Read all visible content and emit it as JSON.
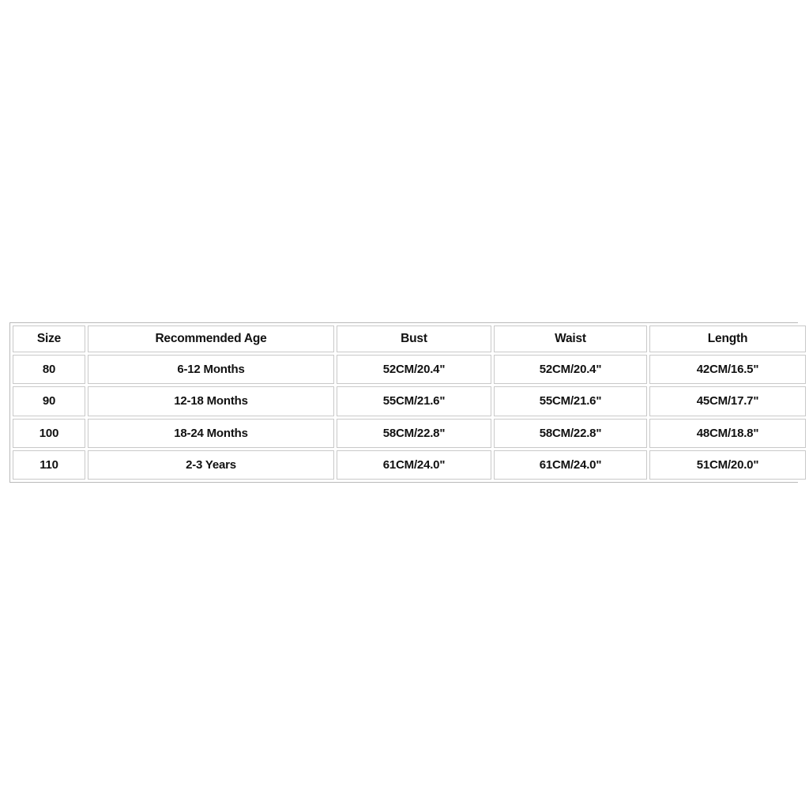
{
  "chart_data": {
    "type": "table",
    "title": "",
    "columns": [
      "Size",
      "Recommended Age",
      "Bust",
      "Waist",
      "Length"
    ],
    "rows": [
      [
        "80",
        "6-12 Months",
        "52CM/20.4\"",
        "52CM/20.4\"",
        "42CM/16.5\""
      ],
      [
        "90",
        "12-18 Months",
        "55CM/21.6\"",
        "55CM/21.6\"",
        "45CM/17.7\""
      ],
      [
        "100",
        "18-24 Months",
        "58CM/22.8\"",
        "58CM/22.8\"",
        "48CM/18.8\""
      ],
      [
        "110",
        "2-3 Years",
        "61CM/24.0\"",
        "61CM/24.0\"",
        "51CM/20.0\""
      ]
    ]
  },
  "size_chart": {
    "headers": {
      "size": "Size",
      "recommended_age": "Recommended Age",
      "bust": "Bust",
      "waist": "Waist",
      "length": "Length"
    },
    "rows": [
      {
        "size": "80",
        "recommended_age": "6-12 Months",
        "bust": "52CM/20.4\"",
        "waist": "52CM/20.4\"",
        "length": "42CM/16.5\""
      },
      {
        "size": "90",
        "recommended_age": "12-18 Months",
        "bust": "55CM/21.6\"",
        "waist": "55CM/21.6\"",
        "length": "45CM/17.7\""
      },
      {
        "size": "100",
        "recommended_age": "18-24 Months",
        "bust": "58CM/22.8\"",
        "waist": "58CM/22.8\"",
        "length": "48CM/18.8\""
      },
      {
        "size": "110",
        "recommended_age": "2-3 Years",
        "bust": "61CM/24.0\"",
        "waist": "61CM/24.0\"",
        "length": "51CM/20.0\""
      }
    ]
  },
  "colors": {
    "page_background": "#ffffff",
    "cell_background": "#ffffff",
    "cell_border": "#c9c9c9",
    "table_outer_border": "#b9b9b9",
    "text": "#111111"
  }
}
